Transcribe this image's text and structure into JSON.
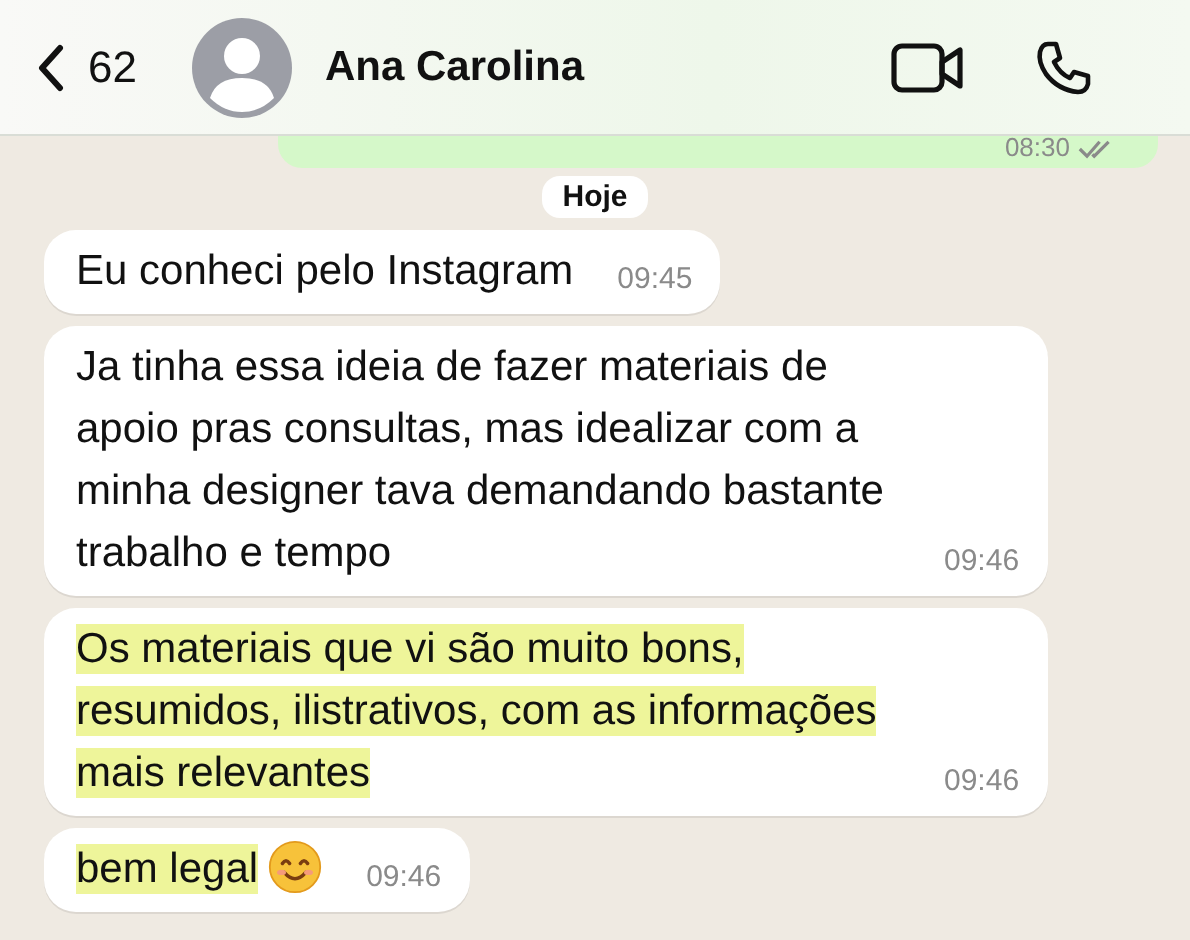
{
  "header": {
    "back_count": "62",
    "contact_name": "Ana Carolina"
  },
  "outgoing_preview": {
    "time": "08:30"
  },
  "date_chip": "Hoje",
  "messages": [
    {
      "text": "Eu conheci pelo Instagram",
      "time": "09:45",
      "highlighted": false,
      "emoji": false
    },
    {
      "text": "Ja tinha essa ideia de fazer materiais de apoio pras consultas, mas idealizar com a minha designer tava demandando bastante trabalho e tempo",
      "time": "09:46",
      "highlighted": false,
      "emoji": false
    },
    {
      "text": "Os materiais que vi são muito bons, resumidos, ilistrativos, com as informações mais relevantes",
      "time": "09:46",
      "highlighted": true,
      "emoji": false
    },
    {
      "text": "bem legal",
      "time": "09:46",
      "highlighted": true,
      "emoji": true
    }
  ]
}
